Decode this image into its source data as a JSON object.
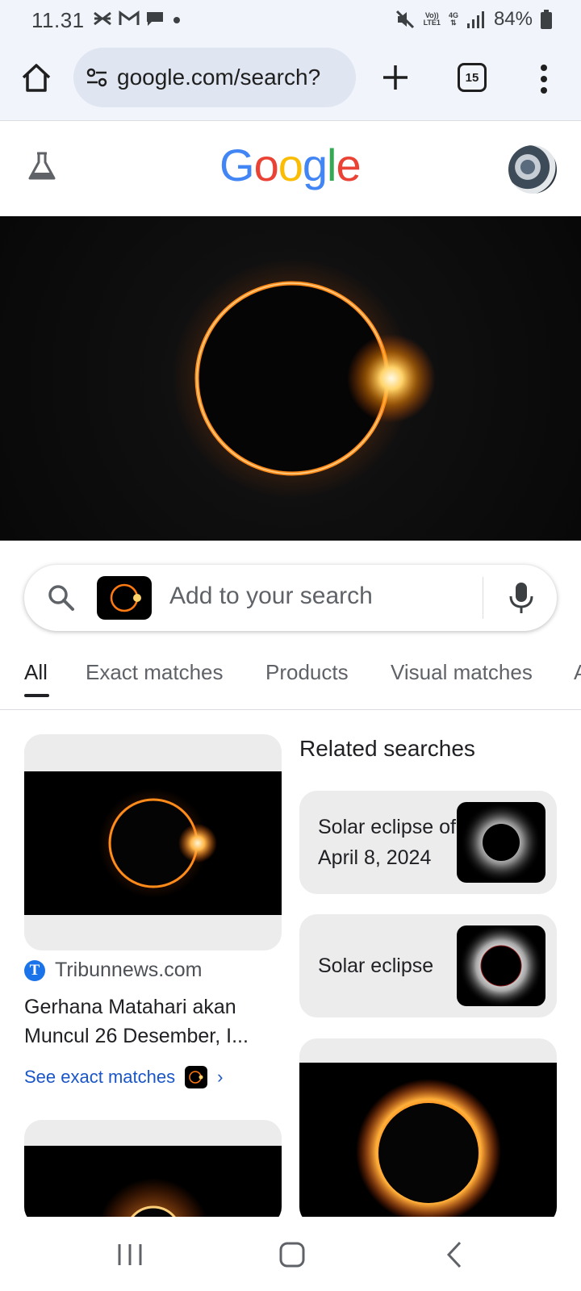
{
  "status_bar": {
    "time": "11.31",
    "network_top": "Vo))",
    "network_bottom": "LTE1",
    "data_top": "4G",
    "battery": "84%"
  },
  "browser": {
    "url": "google.com/search?",
    "tab_count": "15"
  },
  "header": {
    "logo": [
      "G",
      "o",
      "o",
      "g",
      "l",
      "e"
    ],
    "logo_colors": [
      "#4285F4",
      "#EA4335",
      "#FBBC05",
      "#4285F4",
      "#34A853",
      "#EA4335"
    ]
  },
  "search": {
    "placeholder": "Add to your search"
  },
  "tabs": [
    "All",
    "Exact matches",
    "Products",
    "Visual matches",
    "A"
  ],
  "result": {
    "source_icon_letter": "T",
    "source": "Tribunnews.com",
    "title_line1": "Gerhana Matahari akan",
    "title_line2": "Muncul 26 Desember, I...",
    "exact_matches": "See exact matches",
    "chevron": "›"
  },
  "related": {
    "heading": "Related searches",
    "items": [
      {
        "line1": "Solar eclipse of",
        "line2": "April 8, 2024"
      },
      {
        "line1": "Solar eclipse",
        "line2": ""
      }
    ]
  }
}
